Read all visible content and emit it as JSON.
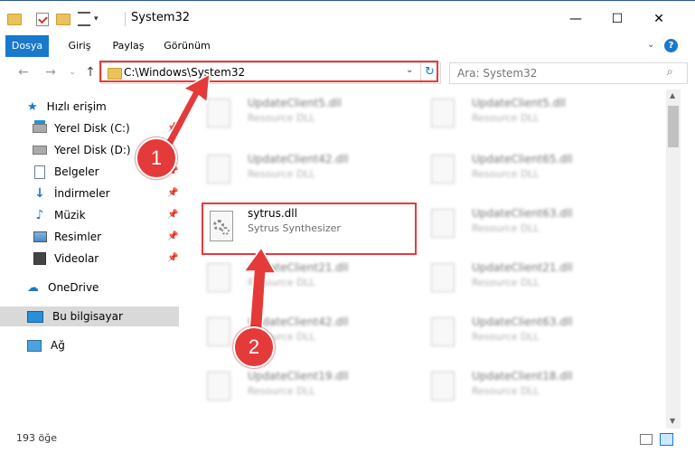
{
  "window": {
    "title": "System32",
    "colors": {
      "accent": "#1979ca",
      "annotation": "#e53a3a"
    }
  },
  "ribbon": {
    "tabs": [
      {
        "label": "Dosya",
        "active": true
      },
      {
        "label": "Giriş"
      },
      {
        "label": "Paylaş"
      },
      {
        "label": "Görünüm"
      }
    ],
    "help": "?"
  },
  "toolbar": {
    "window_buttons": {
      "minimize": "—",
      "maximize": "☐",
      "close": "✕"
    }
  },
  "address": {
    "path": "C:\\Windows\\System32"
  },
  "search": {
    "placeholder": "Ara: System32"
  },
  "sidebar": {
    "quick_access": "Hızlı erişim",
    "items": [
      {
        "label": "Yerel Disk (C:)"
      },
      {
        "label": "Yerel Disk (D:)"
      },
      {
        "label": "Belgeler"
      },
      {
        "label": "İndirmeler"
      },
      {
        "label": "Müzik"
      },
      {
        "label": "Resimler"
      },
      {
        "label": "Videolar"
      }
    ],
    "onedrive": "OneDrive",
    "this_pc": "Bu bilgisayar",
    "network": "Ağ"
  },
  "files": {
    "col1": [
      {
        "name": "UpdateClient5.dll",
        "desc": "Resource DLL"
      },
      {
        "name": "UpdateClient42.dll",
        "desc": "Resource DLL"
      },
      {
        "name": "sytrus.dll",
        "desc": "Sytrus Synthesizer"
      },
      {
        "name": "UpdateClient21.dll",
        "desc": "Resource DLL"
      },
      {
        "name": "UpdateClient42.dll",
        "desc": "Resource DLL"
      },
      {
        "name": "UpdateClient19.dll",
        "desc": "Resource DLL"
      }
    ],
    "col2": [
      {
        "name": "UpdateClient5.dll",
        "desc": "Resource DLL"
      },
      {
        "name": "UpdateClient65.dll",
        "desc": "Resource DLL"
      },
      {
        "name": "UpdateClient63.dll",
        "desc": "Resource DLL"
      },
      {
        "name": "UpdateClient21.dll",
        "desc": "Resource DLL"
      },
      {
        "name": "UpdateClient63.dll",
        "desc": "Resource DLL"
      },
      {
        "name": "UpdateClient18.dll",
        "desc": "Resource DLL"
      }
    ]
  },
  "annotations": {
    "step1": "1",
    "step2": "2"
  },
  "status": {
    "count": "193 öğe"
  }
}
